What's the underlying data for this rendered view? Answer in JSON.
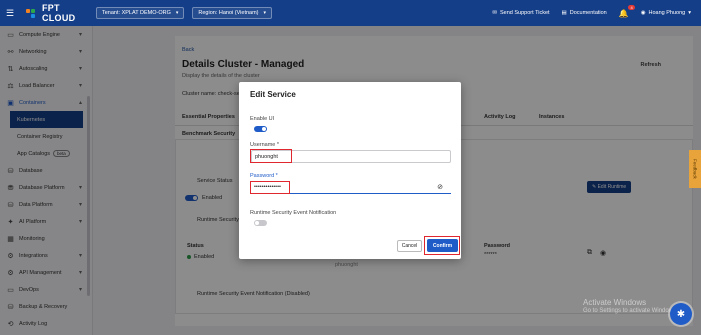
{
  "topbar": {
    "brand": "FPT CLOUD",
    "tenant": "Tenant: XPLAT DEMO-ORG",
    "region": "Region: Hanoi (Vietnam)",
    "support": "Send Support Ticket",
    "docs": "Documentation",
    "notif_count": "4",
    "user": "Hoang Phuong"
  },
  "sidebar": {
    "items": [
      {
        "label": "Compute Engine"
      },
      {
        "label": "Networking"
      },
      {
        "label": "Autoscaling"
      },
      {
        "label": "Load Balancer"
      },
      {
        "label": "Containers"
      },
      {
        "label": "Kubernetes"
      },
      {
        "label": "Container Registry"
      },
      {
        "label": "App Catalogs"
      },
      {
        "label": "Database"
      },
      {
        "label": "Database Platform"
      },
      {
        "label": "Data Platform"
      },
      {
        "label": "AI Platform"
      },
      {
        "label": "Monitoring"
      },
      {
        "label": "Integrations"
      },
      {
        "label": "API Management"
      },
      {
        "label": "DevOps"
      },
      {
        "label": "Backup & Recovery"
      },
      {
        "label": "Activity Log"
      }
    ],
    "beta": "beta"
  },
  "page": {
    "back": "Back",
    "title": "Details Cluster - Managed",
    "subtitle": "Display the details of the cluster",
    "refresh": "Refresh",
    "cluster_name_label": "Cluster name: check-secu",
    "tabs": [
      "Essential Properties",
      "Activity Log",
      "Instances"
    ],
    "bench_title": "Benchmark Security",
    "edit_runtime": "Edit Runtime",
    "service_status": "Service Status",
    "enabled": "Enabled",
    "runtime_ui": "Runtime Security UI",
    "status_h": "Status",
    "status_v": "Enabled",
    "username_v": "phuonght",
    "password_h": "Password",
    "password_v": "******",
    "notif_disabled": "Runtime Security Event Notification (Disabled)"
  },
  "modal": {
    "title": "Edit Service",
    "enable_ui": "Enable UI",
    "username_label": "Username *",
    "username_value": "phuonght",
    "password_label": "Password *",
    "password_value": "••••••••••••••",
    "notification_label": "Runtime Security Event Notification",
    "cancel": "Cancel",
    "confirm": "Confirm"
  },
  "feedback": "Feedback",
  "watermark": {
    "line1": "Activate Windows",
    "line2": "Go to Settings to activate Windows."
  },
  "colors": {
    "brand": "#153e88",
    "accent": "#1f5cc8",
    "highlight": "#e0262f"
  }
}
